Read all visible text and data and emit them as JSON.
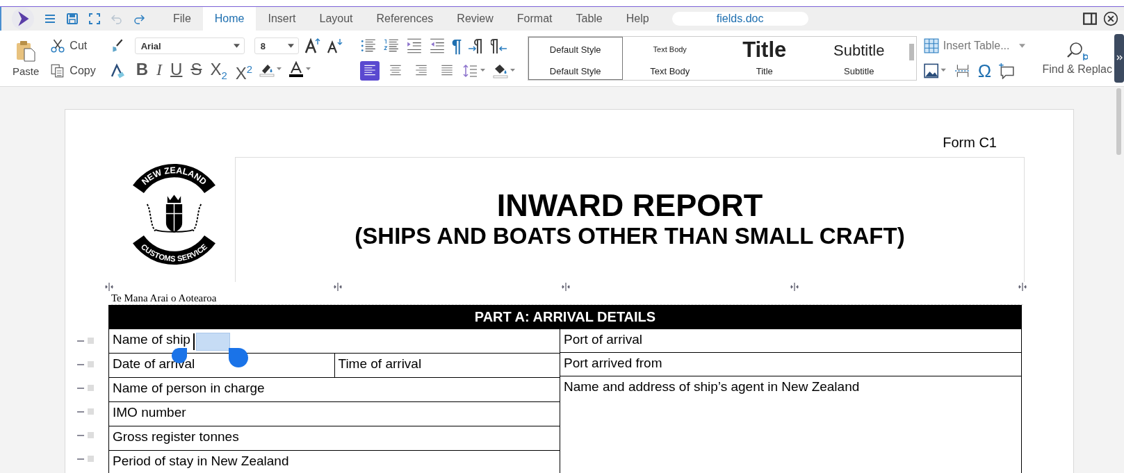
{
  "app": {
    "tabs": [
      {
        "label": "File",
        "selected": false
      },
      {
        "label": "Home",
        "selected": true
      },
      {
        "label": "Insert",
        "selected": false
      },
      {
        "label": "Layout",
        "selected": false
      },
      {
        "label": "References",
        "selected": false
      },
      {
        "label": "Review",
        "selected": false
      },
      {
        "label": "Format",
        "selected": false
      },
      {
        "label": "Table",
        "selected": false
      },
      {
        "label": "Help",
        "selected": false
      }
    ],
    "document_name": "fields.doc"
  },
  "ribbon": {
    "paste": "Paste",
    "cut": "Cut",
    "copy": "Copy",
    "font": "Arial",
    "font_size": "8",
    "format_buttons": [
      {
        "kind": "bold",
        "glyph": "B"
      },
      {
        "kind": "italic",
        "glyph": "I"
      },
      {
        "kind": "underline",
        "glyph": "U"
      },
      {
        "kind": "strike",
        "glyph": "S"
      },
      {
        "kind": "subscript",
        "glyph": "X",
        "mark": "2"
      },
      {
        "kind": "superscript",
        "glyph": "X",
        "mark": "2"
      }
    ],
    "pilcrow": "¶",
    "align_buttons": [
      {
        "kind": "left",
        "selected": true
      },
      {
        "kind": "center",
        "selected": false
      },
      {
        "kind": "right",
        "selected": false
      },
      {
        "kind": "justify",
        "selected": false
      }
    ],
    "styles": [
      {
        "kind": "default",
        "preview": "Default Style",
        "label": "Default Style",
        "selected": true
      },
      {
        "kind": "body",
        "preview": "Text Body",
        "label": "Text Body",
        "selected": false
      },
      {
        "kind": "title",
        "preview": "Title",
        "label": "Title",
        "selected": false
      },
      {
        "kind": "subtitle",
        "preview": "Subtitle",
        "label": "Subtitle",
        "selected": false
      }
    ],
    "insert_table": "Insert Table...",
    "omega": "Ω",
    "find_replace": "Find & Replac"
  },
  "document": {
    "form_code": "Form C1",
    "logo": {
      "top_text": "NEW ZEALAND",
      "bottom_text": "CUSTOMS SERVICE"
    },
    "motto": "Te Mana Arai o Aotearoa",
    "title": "INWARD REPORT",
    "subtitle": "(SHIPS AND BOATS OTHER THAN SMALL CRAFT)",
    "table": {
      "heading": "PART A: ARRIVAL DETAILS",
      "left_rows": [
        [
          "Name of ship"
        ],
        [
          "Date of arrival",
          "Time of arrival"
        ],
        [
          "Name of person in charge"
        ],
        [
          "IMO number"
        ],
        [
          "Gross register tonnes"
        ],
        [
          "Period of stay in New Zealand"
        ]
      ],
      "right_cells": [
        "Port of arrival",
        "Port arrived from",
        "Name and address of ship’s agent in New Zealand"
      ]
    }
  }
}
